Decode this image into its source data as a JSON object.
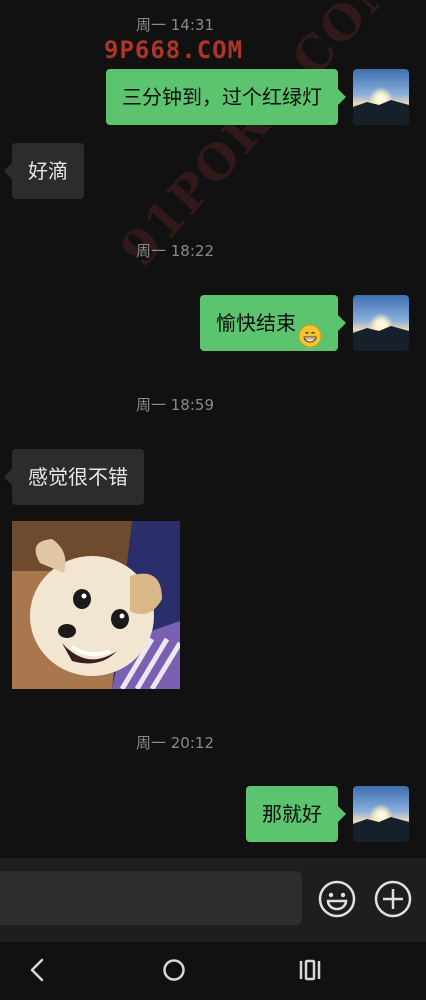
{
  "watermarks": {
    "top": "9P668.COM",
    "diagonal": "91PORN.COM"
  },
  "messages": [
    {
      "type": "timestamp",
      "text": "周一 14:31"
    },
    {
      "type": "outgoing",
      "text": "三分钟到，过个红绿灯"
    },
    {
      "type": "incoming",
      "text": "好滴"
    },
    {
      "type": "timestamp",
      "text": "周一 18:22"
    },
    {
      "type": "outgoing",
      "text": "愉快结束",
      "emoji": "grinning-face"
    },
    {
      "type": "timestamp",
      "text": "周一 18:59"
    },
    {
      "type": "incoming",
      "text": "感觉很不错"
    },
    {
      "type": "incoming-sticker",
      "sticker": "smiling-dog-photo"
    },
    {
      "type": "timestamp",
      "text": "周一 20:12"
    },
    {
      "type": "outgoing",
      "text": "那就好"
    }
  ],
  "input_bar": {
    "emoji_button_icon": "smiley-icon",
    "more_button_icon": "plus-circle-icon"
  },
  "navbar": {
    "back_icon": "back-chevron-icon",
    "home_icon": "home-circle-icon",
    "recents_icon": "recents-icon"
  },
  "colors": {
    "background": "#111111",
    "outgoing_bubble": "#5cc46e",
    "incoming_bubble": "#2c2c2c",
    "timestamp": "#8a8a8a",
    "watermark": "#c0392b"
  }
}
